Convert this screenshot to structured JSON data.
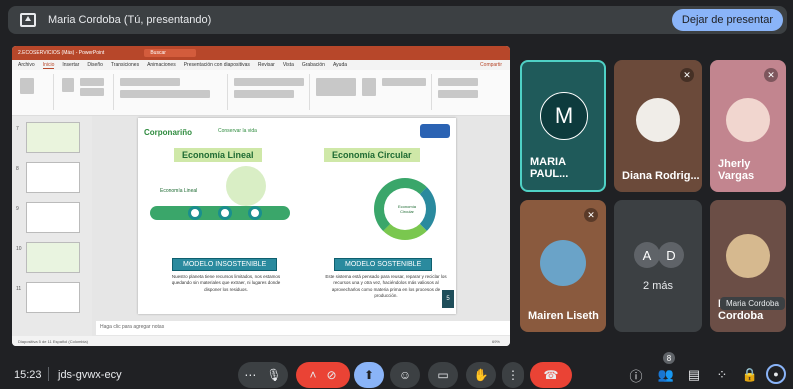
{
  "topbar": {
    "presenting_label": "Maria Cordoba (Tú, presentando)",
    "stop_button": "Dejar de presentar"
  },
  "share": {
    "app_title": "2.ECOSERVICIOS (Más) - PowerPoint",
    "search_placeholder": "Buscar",
    "tabs": [
      "Archivo",
      "Inicio",
      "Insertar",
      "Diseño",
      "Transiciones",
      "Animaciones",
      "Presentación con diapositivas",
      "Revisar",
      "Vista",
      "Grabación",
      "Ayuda"
    ],
    "active_tab": "Inicio",
    "share_label": "Compartir",
    "thumb_numbers": [
      "7",
      "8",
      "9",
      "10",
      "11"
    ],
    "notes_placeholder": "Haga clic para agregar notas",
    "status": "Diapositiva 5 de 11    Español (Colombia)",
    "zoom": "69%",
    "slide": {
      "logo": "Corponariño",
      "slogan": "Conservar la vida",
      "left_heading": "Economía Lineal",
      "right_heading": "Economía Circular",
      "left_model": "MODELO INSOSTENIBLE",
      "right_model": "MODELO SOSTENIBLE",
      "left_desc": "Nuestro planeta tiene recursos limitados, nos estamos quedando sin materiales que extraer, ni lugares donde disponer los residuos.",
      "right_desc": "Este sistema está pensado para reusar, reparar y reciclar los recursos una y otra vez, haciéndolos más valiosos al aprovecharlos como materia prima en los procesos de producción.",
      "left_chain_label": "Economía Lineal",
      "right_center_label": "Economía Circular",
      "page_badge": "5"
    }
  },
  "tiles": [
    {
      "name": "MARIA PAUL...",
      "initial": "M",
      "bg": "#1f5a5a",
      "avatar_bg": "#0d3b3d",
      "highlight": true
    },
    {
      "name": "Diana Rodrig...",
      "bg": "#6b4a3a",
      "muted": true
    },
    {
      "name": "Jherly Vargas",
      "bg": "#c2858f",
      "muted": true
    },
    {
      "name": "Mairen Liseth",
      "bg": "#8a5a3e",
      "muted": true
    },
    {
      "name": "2 más",
      "initials": [
        "A",
        "D"
      ],
      "bg": "#3c4043"
    },
    {
      "name": "Maria Cordoba",
      "bg": "#6b4e46"
    }
  ],
  "tooltip": "Maria Cordoba",
  "bottom": {
    "time": "15:23",
    "meeting_code": "jds-gvwx-ecy",
    "participant_count": "8"
  },
  "colors": {
    "accent": "#8ab4f8",
    "end_call": "#ea4335",
    "ppt_brand": "#b7472a"
  }
}
